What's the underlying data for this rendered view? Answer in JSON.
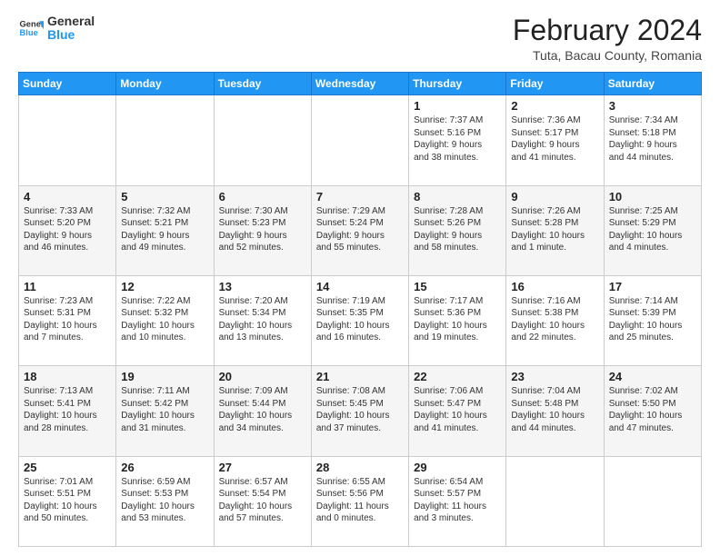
{
  "logo": {
    "line1": "General",
    "line2": "Blue"
  },
  "title": "February 2024",
  "location": "Tuta, Bacau County, Romania",
  "days_of_week": [
    "Sunday",
    "Monday",
    "Tuesday",
    "Wednesday",
    "Thursday",
    "Friday",
    "Saturday"
  ],
  "weeks": [
    [
      {
        "day": "",
        "info": ""
      },
      {
        "day": "",
        "info": ""
      },
      {
        "day": "",
        "info": ""
      },
      {
        "day": "",
        "info": ""
      },
      {
        "day": "1",
        "info": "Sunrise: 7:37 AM\nSunset: 5:16 PM\nDaylight: 9 hours\nand 38 minutes."
      },
      {
        "day": "2",
        "info": "Sunrise: 7:36 AM\nSunset: 5:17 PM\nDaylight: 9 hours\nand 41 minutes."
      },
      {
        "day": "3",
        "info": "Sunrise: 7:34 AM\nSunset: 5:18 PM\nDaylight: 9 hours\nand 44 minutes."
      }
    ],
    [
      {
        "day": "4",
        "info": "Sunrise: 7:33 AM\nSunset: 5:20 PM\nDaylight: 9 hours\nand 46 minutes."
      },
      {
        "day": "5",
        "info": "Sunrise: 7:32 AM\nSunset: 5:21 PM\nDaylight: 9 hours\nand 49 minutes."
      },
      {
        "day": "6",
        "info": "Sunrise: 7:30 AM\nSunset: 5:23 PM\nDaylight: 9 hours\nand 52 minutes."
      },
      {
        "day": "7",
        "info": "Sunrise: 7:29 AM\nSunset: 5:24 PM\nDaylight: 9 hours\nand 55 minutes."
      },
      {
        "day": "8",
        "info": "Sunrise: 7:28 AM\nSunset: 5:26 PM\nDaylight: 9 hours\nand 58 minutes."
      },
      {
        "day": "9",
        "info": "Sunrise: 7:26 AM\nSunset: 5:28 PM\nDaylight: 10 hours\nand 1 minute."
      },
      {
        "day": "10",
        "info": "Sunrise: 7:25 AM\nSunset: 5:29 PM\nDaylight: 10 hours\nand 4 minutes."
      }
    ],
    [
      {
        "day": "11",
        "info": "Sunrise: 7:23 AM\nSunset: 5:31 PM\nDaylight: 10 hours\nand 7 minutes."
      },
      {
        "day": "12",
        "info": "Sunrise: 7:22 AM\nSunset: 5:32 PM\nDaylight: 10 hours\nand 10 minutes."
      },
      {
        "day": "13",
        "info": "Sunrise: 7:20 AM\nSunset: 5:34 PM\nDaylight: 10 hours\nand 13 minutes."
      },
      {
        "day": "14",
        "info": "Sunrise: 7:19 AM\nSunset: 5:35 PM\nDaylight: 10 hours\nand 16 minutes."
      },
      {
        "day": "15",
        "info": "Sunrise: 7:17 AM\nSunset: 5:36 PM\nDaylight: 10 hours\nand 19 minutes."
      },
      {
        "day": "16",
        "info": "Sunrise: 7:16 AM\nSunset: 5:38 PM\nDaylight: 10 hours\nand 22 minutes."
      },
      {
        "day": "17",
        "info": "Sunrise: 7:14 AM\nSunset: 5:39 PM\nDaylight: 10 hours\nand 25 minutes."
      }
    ],
    [
      {
        "day": "18",
        "info": "Sunrise: 7:13 AM\nSunset: 5:41 PM\nDaylight: 10 hours\nand 28 minutes."
      },
      {
        "day": "19",
        "info": "Sunrise: 7:11 AM\nSunset: 5:42 PM\nDaylight: 10 hours\nand 31 minutes."
      },
      {
        "day": "20",
        "info": "Sunrise: 7:09 AM\nSunset: 5:44 PM\nDaylight: 10 hours\nand 34 minutes."
      },
      {
        "day": "21",
        "info": "Sunrise: 7:08 AM\nSunset: 5:45 PM\nDaylight: 10 hours\nand 37 minutes."
      },
      {
        "day": "22",
        "info": "Sunrise: 7:06 AM\nSunset: 5:47 PM\nDaylight: 10 hours\nand 41 minutes."
      },
      {
        "day": "23",
        "info": "Sunrise: 7:04 AM\nSunset: 5:48 PM\nDaylight: 10 hours\nand 44 minutes."
      },
      {
        "day": "24",
        "info": "Sunrise: 7:02 AM\nSunset: 5:50 PM\nDaylight: 10 hours\nand 47 minutes."
      }
    ],
    [
      {
        "day": "25",
        "info": "Sunrise: 7:01 AM\nSunset: 5:51 PM\nDaylight: 10 hours\nand 50 minutes."
      },
      {
        "day": "26",
        "info": "Sunrise: 6:59 AM\nSunset: 5:53 PM\nDaylight: 10 hours\nand 53 minutes."
      },
      {
        "day": "27",
        "info": "Sunrise: 6:57 AM\nSunset: 5:54 PM\nDaylight: 10 hours\nand 57 minutes."
      },
      {
        "day": "28",
        "info": "Sunrise: 6:55 AM\nSunset: 5:56 PM\nDaylight: 11 hours\nand 0 minutes."
      },
      {
        "day": "29",
        "info": "Sunrise: 6:54 AM\nSunset: 5:57 PM\nDaylight: 11 hours\nand 3 minutes."
      },
      {
        "day": "",
        "info": ""
      },
      {
        "day": "",
        "info": ""
      }
    ]
  ]
}
